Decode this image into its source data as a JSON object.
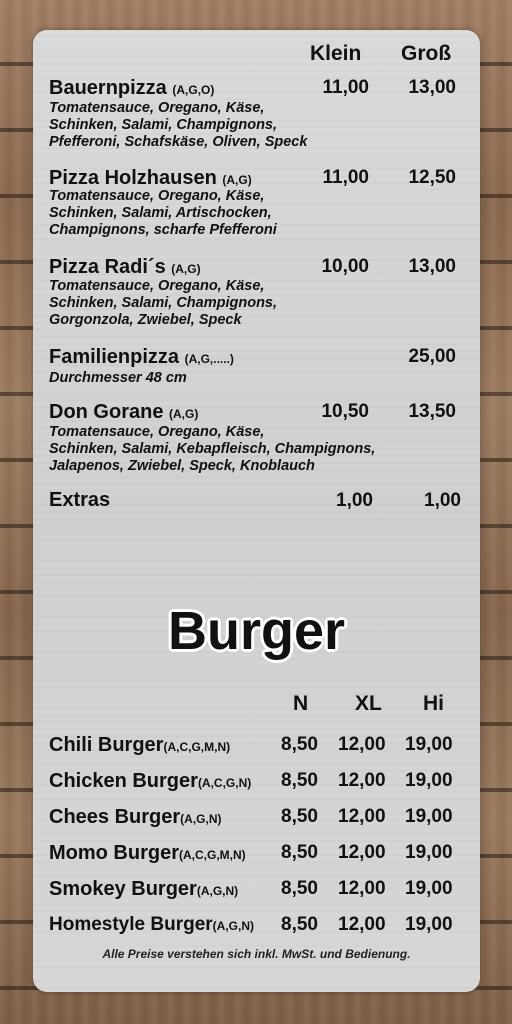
{
  "pizza": {
    "headers": {
      "klein": "Klein",
      "gross": "Groß"
    },
    "items": [
      {
        "name": "Bauernpizza",
        "allergens": "(A,G,O)",
        "klein": "11,00",
        "gross": "13,00",
        "desc": [
          "Tomatensauce, Oregano, Käse,",
          "Schinken, Salami, Champignons,",
          "Pfefferoni, Schafskäse, Oliven, Speck"
        ]
      },
      {
        "name": "Pizza Holzhausen",
        "allergens": "(A,G)",
        "klein": "11,00",
        "gross": "12,50",
        "desc": [
          "Tomatensauce, Oregano, Käse,",
          "Schinken, Salami, Artischocken,",
          "Champignons, scharfe Pfefferoni"
        ]
      },
      {
        "name": "Pizza Radi´s",
        "allergens": "(A,G)",
        "klein": "10,00",
        "gross": "13,00",
        "desc": [
          "Tomatensauce, Oregano, Käse,",
          "Schinken, Salami, Champignons,",
          "Gorgonzola, Zwiebel, Speck"
        ]
      },
      {
        "name": "Familienpizza",
        "allergens": "(A,G,.....)",
        "klein": "",
        "gross": "25,00",
        "desc": [
          "Durchmesser 48 cm"
        ]
      },
      {
        "name": "Don Gorane",
        "allergens": "(A,G)",
        "klein": "10,50",
        "gross": "13,50",
        "desc": [
          "Tomatensauce, Oregano, Käse,",
          "Schinken, Salami, Kebapfleisch, Champignons,",
          "Jalapenos, Zwiebel, Speck, Knoblauch"
        ]
      },
      {
        "name": "Extras",
        "allergens": "",
        "klein": "1,00",
        "gross": "1,00",
        "desc": []
      }
    ]
  },
  "burger": {
    "title": "Burger",
    "headers": {
      "n": "N",
      "xl": "XL",
      "hi": "Hi"
    },
    "items": [
      {
        "name": "Chili Burger",
        "allergens": "(A,C,G,M,N)",
        "n": "8,50",
        "xl": "12,00",
        "hi": "19,00"
      },
      {
        "name": "Chicken Burger",
        "allergens": "(A,C,G,N)",
        "n": "8,50",
        "xl": "12,00",
        "hi": "19,00"
      },
      {
        "name": "Chees Burger",
        "allergens": "(A,G,N)",
        "n": "8,50",
        "xl": "12,00",
        "hi": "19,00"
      },
      {
        "name": "Momo Burger",
        "allergens": "(A,C,G,M,N)",
        "n": "8,50",
        "xl": "12,00",
        "hi": "19,00"
      },
      {
        "name": "Smokey Burger",
        "allergens": "(A,G,N)",
        "n": "8,50",
        "xl": "12,00",
        "hi": "19,00"
      },
      {
        "name": "Homestyle Burger",
        "allergens": "(A,G,N)",
        "n": "8,50",
        "xl": "12,00",
        "hi": "19,00"
      }
    ]
  },
  "footer": {
    "note": "Alle Preise verstehen sich inkl. MwSt. und Bedienung."
  }
}
